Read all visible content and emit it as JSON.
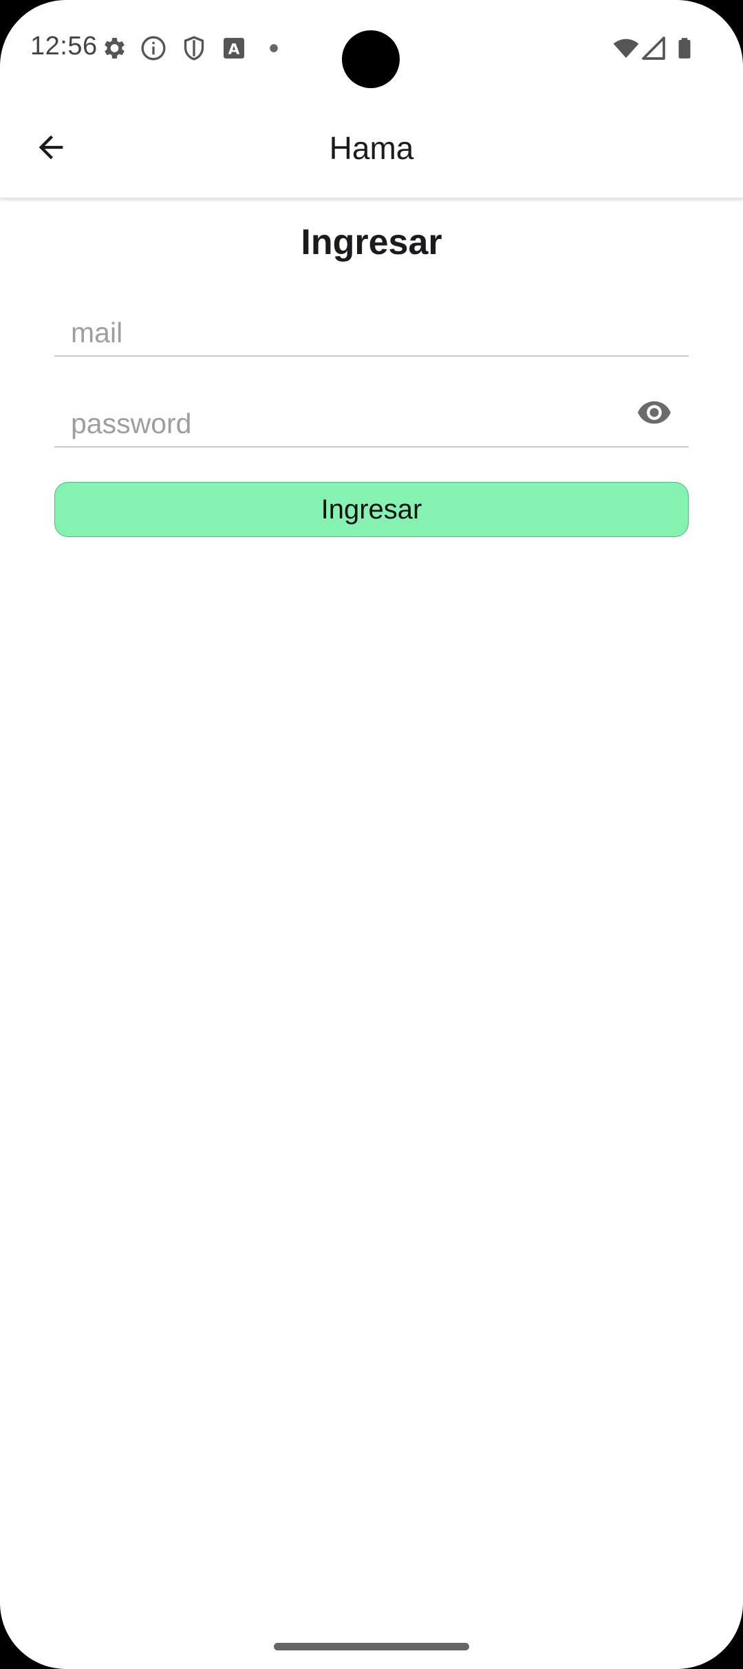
{
  "status_bar": {
    "time": "12:56",
    "icons": [
      "gear-icon",
      "info-icon",
      "shield-icon",
      "text-a-icon",
      "dot-icon"
    ],
    "right_icons": [
      "wifi-icon",
      "cellular-signal-icon",
      "battery-icon"
    ]
  },
  "app_bar": {
    "title": "Hama",
    "back_icon": "arrow-back-icon"
  },
  "login": {
    "heading": "Ingresar",
    "email_placeholder": "mail",
    "email_value": "",
    "password_placeholder": "password",
    "password_value": "",
    "toggle_icon": "eye-icon",
    "submit_label": "Ingresar"
  },
  "colors": {
    "button_fill": "#86f2b2",
    "button_border": "#4fb97c",
    "underline": "#c9c9c9"
  }
}
